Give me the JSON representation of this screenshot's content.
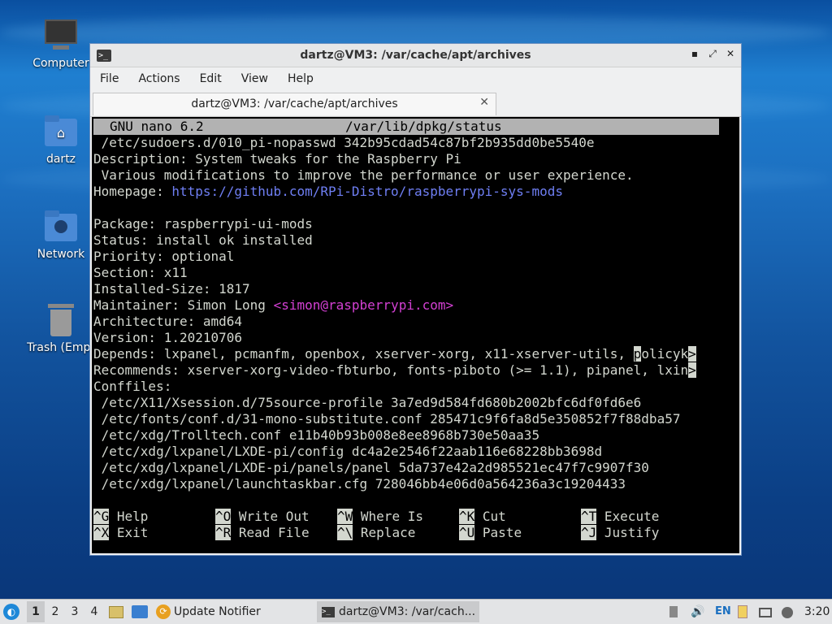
{
  "desktop": {
    "icons": [
      {
        "label": "Computer"
      },
      {
        "label": "dartz"
      },
      {
        "label": "Network"
      },
      {
        "label": "Trash (Empt"
      }
    ]
  },
  "window": {
    "title": "dartz@VM3: /var/cache/apt/archives",
    "menu": [
      "File",
      "Actions",
      "Edit",
      "View",
      "Help"
    ],
    "tab_title": "dartz@VM3: /var/cache/apt/archives",
    "tab_close": "✕"
  },
  "nano": {
    "header_left": "GNU nano 6.2",
    "header_file": "/var/lib/dpkg/status",
    "lines": {
      "l1": " /etc/sudoers.d/010_pi-nopasswd 342b95cdad54c87bf2b935dd0be5540e",
      "l2": "Description: System tweaks for the Raspberry Pi",
      "l3": " Various modifications to improve the performance or user experience.",
      "l4a": "Homepage: ",
      "l4b": "https://github.com/RPi-Distro/raspberrypi-sys-mods",
      "l6": "Package: raspberrypi-ui-mods",
      "l7": "Status: install ok installed",
      "l8": "Priority: optional",
      "l9": "Section: x11",
      "l10": "Installed-Size: 1817",
      "l11a": "Maintainer: Simon Long ",
      "l11b": "<simon@raspberrypi.com>",
      "l12": "Architecture: amd64",
      "l13": "Version: 1.20210706",
      "l14a": "Depends: lxpanel, pcmanfm, openbox, xserver-xorg, x11-xserver-utils, ",
      "l14c": "p",
      "l14d": "olicyk",
      "l14e": ">",
      "l15a": "Recommends: xserver-xorg-video-fbturbo, fonts-piboto (>= 1.1), pipanel, lxin",
      "l15e": ">",
      "l16": "Conffiles:",
      "l17": " /etc/X11/Xsession.d/75source-profile 3a7ed9d584fd680b2002bfc6df0fd6e6",
      "l18": " /etc/fonts/conf.d/31-mono-substitute.conf 285471c9f6fa8d5e350852f7f88dba57",
      "l19": " /etc/xdg/Trolltech.conf e11b40b93b008e8ee8968b730e50aa35",
      "l20": " /etc/xdg/lxpanel/LXDE-pi/config dc4a2e2546f22aab116e68228bb3698d",
      "l21": " /etc/xdg/lxpanel/LXDE-pi/panels/panel 5da737e42a2d985521ec47f7c9907f30",
      "l22": " /etc/xdg/lxpanel/launchtaskbar.cfg 728046bb4e06d0a564236a3c19204433"
    },
    "shortcuts": [
      {
        "key": "^G",
        "label": "Help"
      },
      {
        "key": "^O",
        "label": "Write Out"
      },
      {
        "key": "^W",
        "label": "Where Is"
      },
      {
        "key": "^K",
        "label": "Cut"
      },
      {
        "key": "^T",
        "label": "Execute"
      },
      {
        "key": "^X",
        "label": "Exit"
      },
      {
        "key": "^R",
        "label": "Read File"
      },
      {
        "key": "^\\",
        "label": "Replace"
      },
      {
        "key": "^U",
        "label": "Paste"
      },
      {
        "key": "^J",
        "label": "Justify"
      }
    ]
  },
  "taskbar": {
    "workspaces": [
      "1",
      "2",
      "3",
      "4"
    ],
    "update_notifier": "Update Notifier",
    "terminal_task": "dartz@VM3: /var/cach...",
    "keyboard_layout": "EN",
    "clock": "3:20"
  },
  "colors": {
    "terminal_bg": "#000000",
    "terminal_fg": "#d3d7cf",
    "link_blue": "#6f7ff4",
    "email_magenta": "#d340d3",
    "nano_header": "#b2b2b2"
  }
}
